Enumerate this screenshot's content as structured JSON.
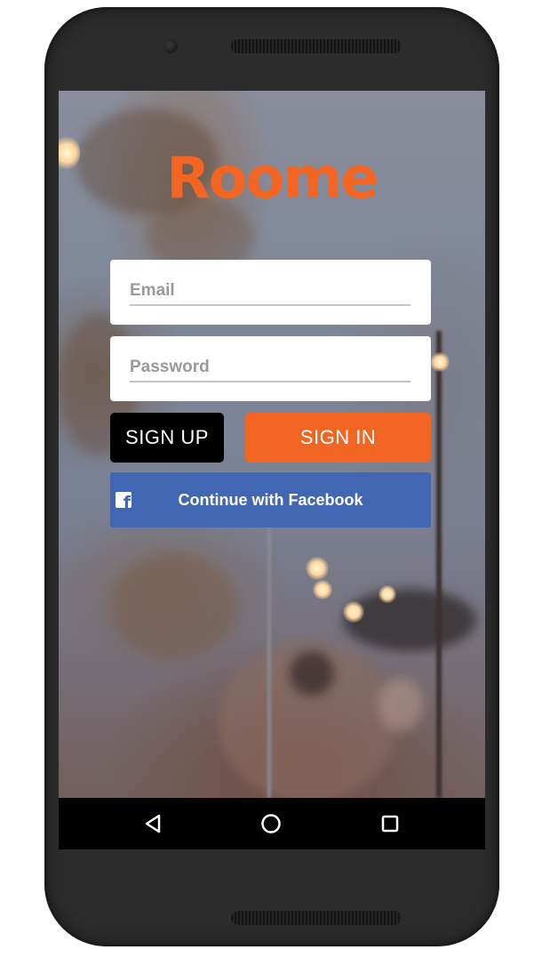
{
  "app": {
    "logo_text": "Roome",
    "brand_color": "#f26522"
  },
  "login": {
    "email_placeholder": "Email",
    "password_placeholder": "Password",
    "signup_label": "SIGN UP",
    "signin_label": "SIGN IN",
    "facebook_label": "Continue with Facebook",
    "facebook_color": "#4267b2"
  },
  "navbar": {
    "buttons": [
      {
        "icon": "back-triangle-icon"
      },
      {
        "icon": "home-circle-icon"
      },
      {
        "icon": "recents-square-icon"
      }
    ]
  }
}
